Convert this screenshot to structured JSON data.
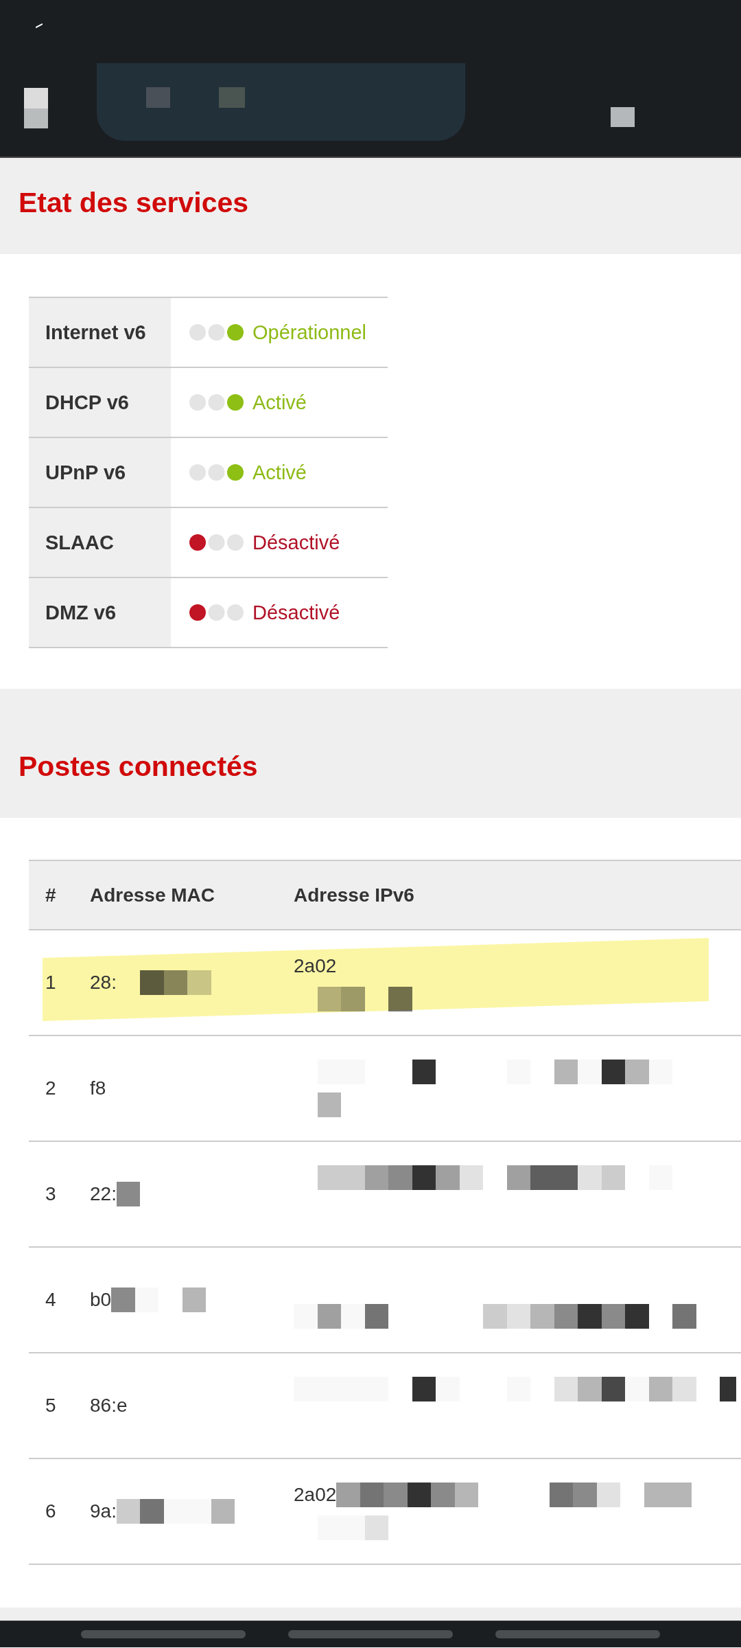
{
  "services_section": {
    "title": "Etat des services",
    "services": [
      {
        "name": "Internet v6",
        "status": "Opérationnel",
        "active": true
      },
      {
        "name": "DHCP v6",
        "status": "Activé",
        "active": true
      },
      {
        "name": "UPnP v6",
        "status": "Activé",
        "active": true
      },
      {
        "name": "SLAAC",
        "status": "Désactivé",
        "active": false
      },
      {
        "name": "DMZ v6",
        "status": "Désactivé",
        "active": false
      }
    ]
  },
  "devices_section": {
    "title": "Postes connectés",
    "table": {
      "columns": [
        "#",
        "Adresse MAC",
        "Adresse IPv6"
      ],
      "rows": [
        {
          "number": "1",
          "mac": "28:",
          "ipv6": "2a02",
          "highlighted": true
        },
        {
          "number": "2",
          "mac": "f8",
          "highlighted": false
        },
        {
          "number": "3",
          "mac": "22:",
          "highlighted": false
        },
        {
          "number": "4",
          "mac": "b0",
          "highlighted": false
        },
        {
          "number": "5",
          "mac": "86:e",
          "highlighted": false
        },
        {
          "number": "6",
          "mac": "9a:",
          "ipv6": "2a02",
          "highlighted": false
        }
      ]
    }
  }
}
